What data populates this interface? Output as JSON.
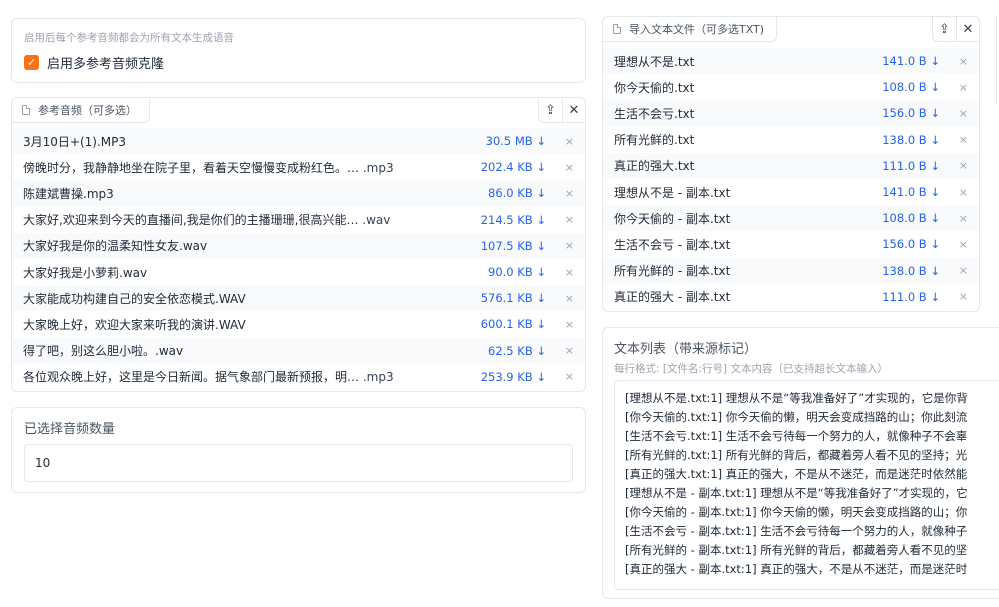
{
  "multi_ref": {
    "hint": "启用后每个参考音频都会为所有文本生成语音",
    "checkbox_label": "启用多参考音频克隆",
    "checked": true
  },
  "ref_audio": {
    "label": "参考音频（可多选）",
    "upload_icon": "upload-icon",
    "close_icon": "close-icon",
    "files": [
      {
        "name": "3月10日+(1).MP3",
        "ext": "",
        "size": "30.5 MB ↓"
      },
      {
        "name": "傍晚时分，我静静地坐在院子里，看着天空慢慢变成粉红色。…",
        "ext": ".mp3",
        "size": "202.4 KB ↓"
      },
      {
        "name": "陈建斌曹操.mp3",
        "ext": "",
        "size": "86.0 KB ↓"
      },
      {
        "name": "大家好,欢迎来到今天的直播间,我是你们的主播珊珊,很高兴能…",
        "ext": ".wav",
        "size": "214.5 KB ↓"
      },
      {
        "name": "大家好我是你的温柔知性女友.wav",
        "ext": "",
        "size": "107.5 KB ↓"
      },
      {
        "name": "大家好我是小萝莉.wav",
        "ext": "",
        "size": "90.0 KB ↓"
      },
      {
        "name": "大家能成功构建自己的安全依恋模式.WAV",
        "ext": "",
        "size": "576.1 KB ↓"
      },
      {
        "name": "大家晚上好，欢迎大家来听我的演讲.WAV",
        "ext": "",
        "size": "600.1 KB ↓"
      },
      {
        "name": "得了吧，别这么胆小啦。.wav",
        "ext": "",
        "size": "62.5 KB ↓"
      },
      {
        "name": "各位观众晚上好，这里是今日新闻。据气象部门最新预报，明…",
        "ext": ".mp3",
        "size": "253.9 KB ↓"
      }
    ]
  },
  "selected_count": {
    "label": "已选择音频数量",
    "value": "10"
  },
  "import_text": {
    "label": "导入文本文件（可多选TXT)",
    "files": [
      {
        "name": "理想从不是.txt",
        "size": "141.0 B ↓"
      },
      {
        "name": "你今天偷的.txt",
        "size": "108.0 B ↓"
      },
      {
        "name": "生活不会亏.txt",
        "size": "156.0 B ↓"
      },
      {
        "name": "所有光鲜的.txt",
        "size": "138.0 B ↓"
      },
      {
        "name": "真正的强大.txt",
        "size": "111.0 B ↓"
      },
      {
        "name": "理想从不是 - 副本.txt",
        "size": "141.0 B ↓"
      },
      {
        "name": "你今天偷的 - 副本.txt",
        "size": "108.0 B ↓"
      },
      {
        "name": "生活不会亏 - 副本.txt",
        "size": "156.0 B ↓"
      },
      {
        "name": "所有光鲜的 - 副本.txt",
        "size": "138.0 B ↓"
      },
      {
        "name": "真正的强大 - 副本.txt",
        "size": "111.0 B ↓"
      }
    ]
  },
  "text_list": {
    "title": "文本列表（带来源标记）",
    "format_hint": "每行格式: [文件名:行号] 文本内容（已支持超长文本输入）",
    "lines": [
      "[理想从不是.txt:1] 理想从不是“等我准备好了”才实现的，它是你背",
      "[你今天偷的.txt:1] 你今天偷的懒，明天会变成挡路的山；你此刻流",
      "[生活不会亏.txt:1] 生活不会亏待每一个努力的人，就像种子不会辜",
      "[所有光鲜的.txt:1] 所有光鲜的背后，都藏着旁人看不见的坚持；光",
      "[真正的强大.txt:1] 真正的强大，不是从不迷茫，而是迷茫时依然能",
      "[理想从不是 - 副本.txt:1] 理想从不是“等我准备好了”才实现的，它",
      "[你今天偷的 - 副本.txt:1] 你今天偷的懒，明天会变成挡路的山；你",
      "[生活不会亏 - 副本.txt:1] 生活不会亏待每一个努力的人，就像种子",
      "[所有光鲜的 - 副本.txt:1] 所有光鲜的背后，都藏着旁人看不见的坚",
      "[真正的强大 - 副本.txt:1] 真正的强大，不是从不迷茫，而是迷茫时"
    ]
  },
  "colors": {
    "accent": "#f97316",
    "link": "#2563eb"
  }
}
